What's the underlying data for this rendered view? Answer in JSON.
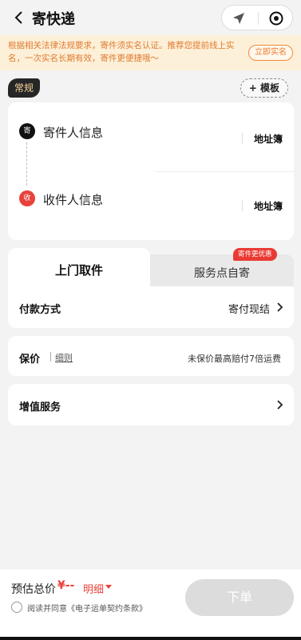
{
  "header": {
    "title": "寄快递",
    "back_icon": "chevron-left-icon",
    "capsule_icons": [
      "navigation-arrow-icon",
      "target-circle-icon"
    ]
  },
  "notice": {
    "text": "根据相关法律法规要求，寄件须实名认证。推荐您提前线上实名，一次实名长期有效，寄件更便捷哦～",
    "button": "立即实名"
  },
  "order_type_tag": "常规",
  "template_button": "+ 模板",
  "sender": {
    "badge": "寄",
    "label": "寄件人信息",
    "address_book": "地址簿"
  },
  "receiver": {
    "badge": "收",
    "label": "收件人信息",
    "address_book": "地址簿"
  },
  "tabs": [
    {
      "label": "上门取件",
      "active": true
    },
    {
      "label": "服务点自寄",
      "active": false,
      "badge": "寄件更优惠"
    }
  ],
  "payment": {
    "label": "付款方式",
    "value": "寄付现结"
  },
  "insurance": {
    "label": "保价",
    "detail_link": "细则",
    "value": "未保价最高赔付7倍运费"
  },
  "value_added": {
    "label": "增值服务"
  },
  "footer": {
    "estimate_label": "预估总价",
    "price": "¥--",
    "detail_link": "明细",
    "agree_text": "阅读并同意《电子运单契约条款》",
    "submit": "下单"
  },
  "colors": {
    "accent_red": "#e8423b",
    "notice_bg": "#fdf0d8",
    "notice_text": "#e07a30",
    "tag_bg": "#262626",
    "tag_text": "#f6d49a",
    "disabled_button": "#dcdcdc"
  }
}
